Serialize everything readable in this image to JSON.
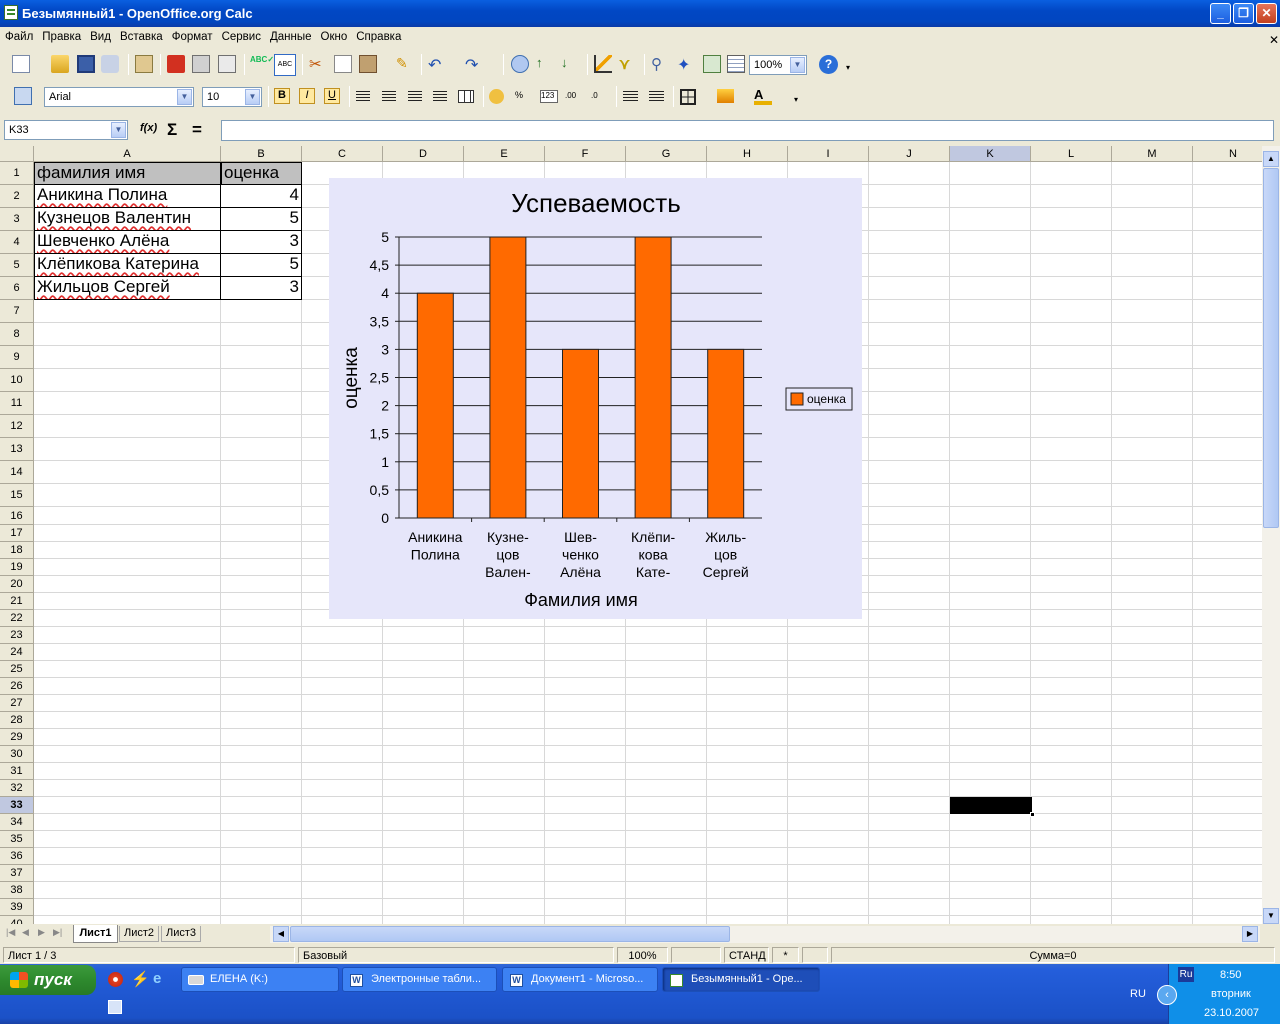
{
  "window": {
    "title": "Безымянный1 - OpenOffice.org Calc"
  },
  "menu": [
    "Файл",
    "Правка",
    "Вид",
    "Вставка",
    "Формат",
    "Сервис",
    "Данные",
    "Окно",
    "Справка"
  ],
  "toolbar": {
    "zoom": "100%",
    "font_name": "Arial",
    "font_size": "10",
    "bold": "B",
    "italic": "I",
    "underline": "U"
  },
  "formula": {
    "cell_ref": "K33",
    "value": ""
  },
  "columns": [
    "A",
    "B",
    "C",
    "D",
    "E",
    "F",
    "G",
    "H",
    "I",
    "J",
    "K",
    "L",
    "M",
    "N"
  ],
  "rows": [
    "1",
    "2",
    "3",
    "4",
    "5",
    "6",
    "7",
    "8",
    "9",
    "10",
    "11",
    "12",
    "13",
    "14",
    "15",
    "16",
    "17",
    "18",
    "19",
    "20",
    "21",
    "22",
    "23",
    "24",
    "25",
    "26",
    "27",
    "28",
    "29",
    "30",
    "31",
    "32",
    "33",
    "34",
    "35",
    "36",
    "37",
    "38",
    "39",
    "40"
  ],
  "active_cell": "K33",
  "table": {
    "header": [
      "фамилия имя",
      "оценка"
    ],
    "rows": [
      {
        "name": "Аникина Полина",
        "score": "4"
      },
      {
        "name": "Кузнецов Валентин",
        "score": "5"
      },
      {
        "name": "Шевченко Алёна",
        "score": "3"
      },
      {
        "name": "Клёпикова Катерина",
        "score": "5"
      },
      {
        "name": "Жильцов Сергей",
        "score": "3"
      }
    ]
  },
  "chart_data": {
    "type": "bar",
    "title": "Успеваемость",
    "xlabel": "Фамилия имя",
    "ylabel": "оценка",
    "categories": [
      [
        "Аникина",
        "Полина"
      ],
      [
        "Кузне-",
        "цов",
        "Вален-"
      ],
      [
        "Шев-",
        "ченко",
        "Алёна"
      ],
      [
        "Клёпи-",
        "кова",
        "Кате-"
      ],
      [
        "Жиль-",
        "цов",
        "Сергей"
      ]
    ],
    "series": [
      {
        "name": "оценка",
        "values": [
          4,
          5,
          3,
          5,
          3
        ]
      }
    ],
    "ylim": [
      0,
      5
    ],
    "yticks": [
      "0",
      "0,5",
      "1",
      "1,5",
      "2",
      "2,5",
      "3",
      "3,5",
      "4",
      "4,5",
      "5"
    ],
    "grid": true,
    "legend": "right",
    "bar_color": "#ff6a00"
  },
  "sheets": [
    "Лист1",
    "Лист2",
    "Лист3"
  ],
  "status": {
    "sheet": "Лист 1 / 3",
    "style": "Базовый",
    "zoom": "100%",
    "mode": "СТАНД",
    "modified": "*",
    "sum": "Сумма=0"
  },
  "taskbar": {
    "start": "пуск",
    "tasks": [
      "ЕЛЕНА (K:)",
      "Электронные табли...",
      "Документ1 - Microso...",
      "Безымянный1 - Ope..."
    ],
    "lang": "RU",
    "lang_indicator": "Ru",
    "time": "8:50",
    "day": "вторник",
    "date": "23.10.2007"
  }
}
